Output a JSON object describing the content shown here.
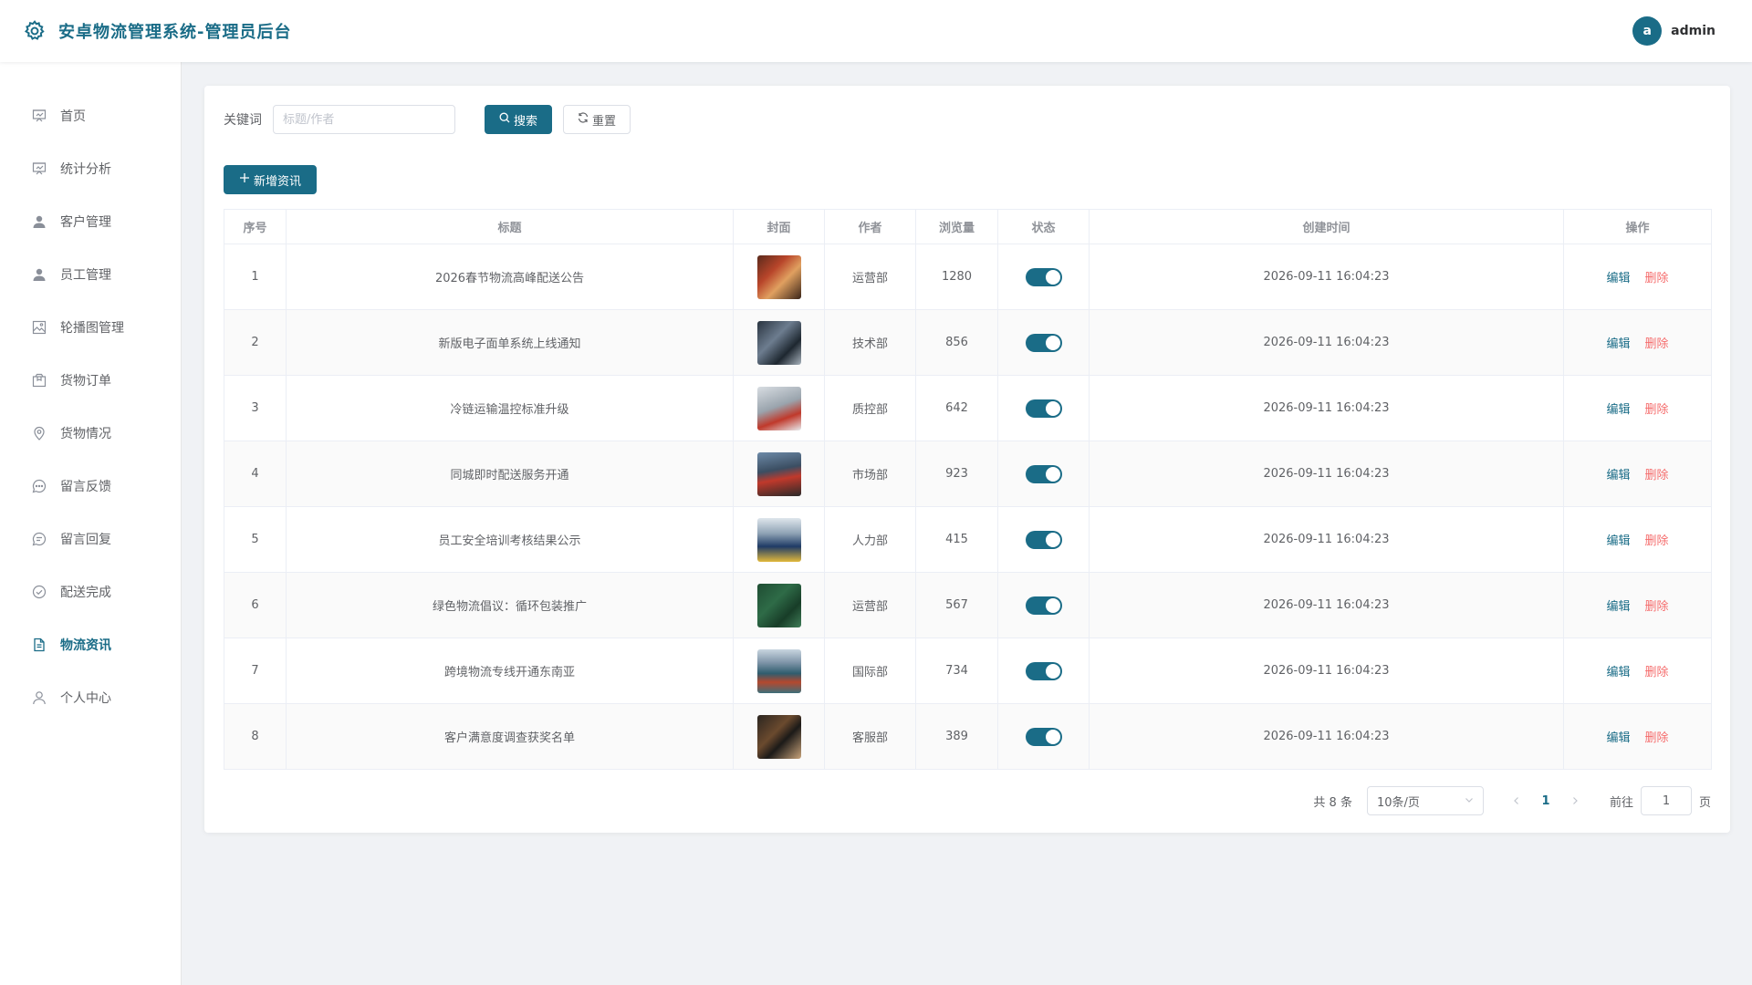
{
  "header": {
    "title": "安卓物流管理系统-管理员后台",
    "avatar_letter": "a",
    "username": "admin"
  },
  "sidebar": {
    "items": [
      {
        "label": "首页",
        "icon": "presentation-icon"
      },
      {
        "label": "统计分析",
        "icon": "presentation-icon"
      },
      {
        "label": "客户管理",
        "icon": "user-filled-icon"
      },
      {
        "label": "员工管理",
        "icon": "user-filled-icon"
      },
      {
        "label": "轮播图管理",
        "icon": "picture-icon"
      },
      {
        "label": "货物订单",
        "icon": "box-icon"
      },
      {
        "label": "货物情况",
        "icon": "location-icon"
      },
      {
        "label": "留言反馈",
        "icon": "chat-dots-icon"
      },
      {
        "label": "留言回复",
        "icon": "chat-line-icon"
      },
      {
        "label": "配送完成",
        "icon": "circle-check-icon"
      },
      {
        "label": "物流资讯",
        "icon": "document-icon",
        "active": true
      },
      {
        "label": "个人中心",
        "icon": "user-icon"
      }
    ]
  },
  "search": {
    "label": "关键词",
    "placeholder": "标题/作者",
    "value": "",
    "search_label": "搜索",
    "reset_label": "重置"
  },
  "actions": {
    "add_label": "新增资讯"
  },
  "table": {
    "columns": [
      "序号",
      "标题",
      "封面",
      "作者",
      "浏览量",
      "状态",
      "创建时间",
      "操作"
    ],
    "edit_label": "编辑",
    "delete_label": "删除",
    "rows": [
      {
        "index": "1",
        "title": "2026春节物流高峰配送公告",
        "author": "运营部",
        "views": "1280",
        "enabled": true,
        "created": "2026-09-11 16:04:23"
      },
      {
        "index": "2",
        "title": "新版电子面单系统上线通知",
        "author": "技术部",
        "views": "856",
        "enabled": true,
        "created": "2026-09-11 16:04:23"
      },
      {
        "index": "3",
        "title": "冷链运输温控标准升级",
        "author": "质控部",
        "views": "642",
        "enabled": true,
        "created": "2026-09-11 16:04:23"
      },
      {
        "index": "4",
        "title": "同城即时配送服务开通",
        "author": "市场部",
        "views": "923",
        "enabled": true,
        "created": "2026-09-11 16:04:23"
      },
      {
        "index": "5",
        "title": "员工安全培训考核结果公示",
        "author": "人力部",
        "views": "415",
        "enabled": true,
        "created": "2026-09-11 16:04:23"
      },
      {
        "index": "6",
        "title": "绿色物流倡议：循环包装推广",
        "author": "运营部",
        "views": "567",
        "enabled": true,
        "created": "2026-09-11 16:04:23"
      },
      {
        "index": "7",
        "title": "跨境物流专线开通东南亚",
        "author": "国际部",
        "views": "734",
        "enabled": true,
        "created": "2026-09-11 16:04:23"
      },
      {
        "index": "8",
        "title": "客户满意度调查获奖名单",
        "author": "客服部",
        "views": "389",
        "enabled": true,
        "created": "2026-09-11 16:04:23"
      }
    ]
  },
  "pagination": {
    "total_text": "共 8 条",
    "page_size": "10条/页",
    "current_page": "1",
    "goto_label": "前往",
    "jump_value": "1",
    "page_suffix": "页"
  },
  "colors": {
    "brand": "#1a6c87",
    "danger": "#f56c6c",
    "background": "#f0f2f5"
  }
}
